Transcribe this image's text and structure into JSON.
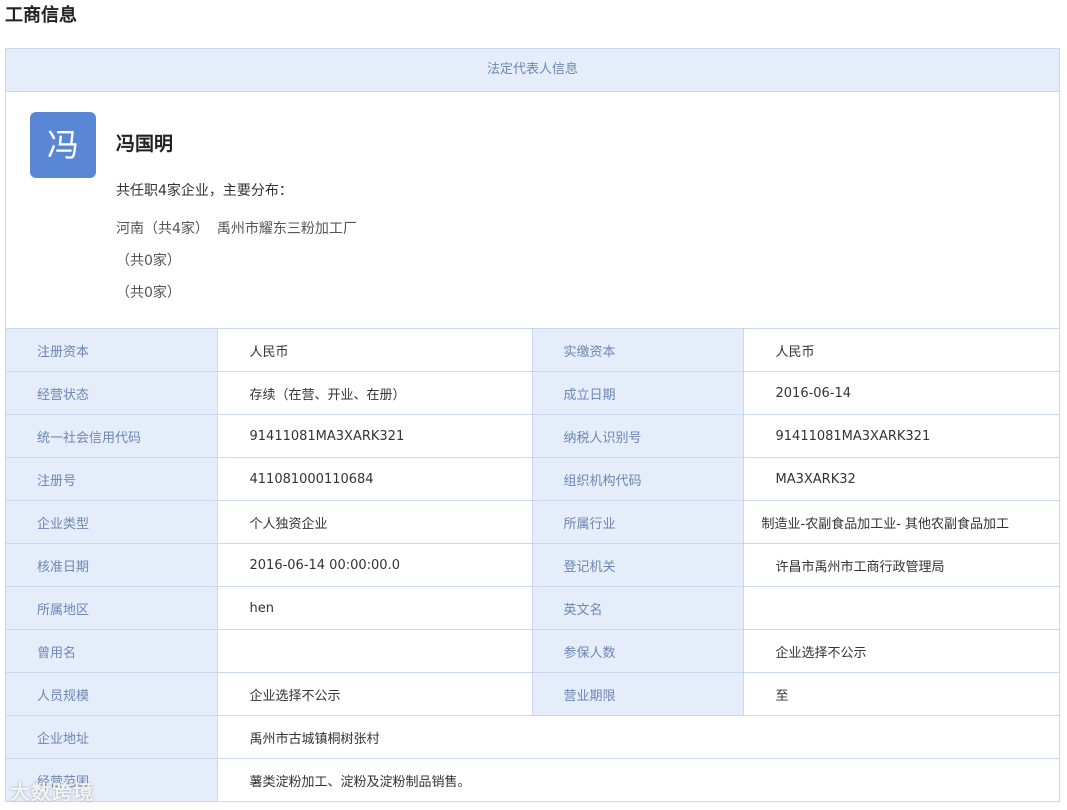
{
  "section_title": "工商信息",
  "panel_header": "法定代表人信息",
  "representative": {
    "avatar_char": "冯",
    "name": "冯国明",
    "summary": "共任职4家企业，主要分布：",
    "distribution": [
      {
        "region": "河南（共4家）",
        "company": "禹州市耀东三粉加工厂"
      },
      {
        "region": "（共0家）",
        "company": ""
      },
      {
        "region": "（共0家）",
        "company": ""
      }
    ]
  },
  "rows": [
    {
      "l1": "注册资本",
      "v1": "人民币",
      "l2": "实缴资本",
      "v2": "人民币"
    },
    {
      "l1": "经营状态",
      "v1": "存续（在营、开业、在册）",
      "l2": "成立日期",
      "v2": "2016-06-14"
    },
    {
      "l1": "统一社会信用代码",
      "v1": "91411081MA3XARK321",
      "l2": "纳税人识别号",
      "v2": "91411081MA3XARK321"
    },
    {
      "l1": "注册号",
      "v1": "411081000110684",
      "l2": "组织机构代码",
      "v2": "MA3XARK32"
    },
    {
      "l1": "企业类型",
      "v1": "个人独资企业",
      "l2": "所属行业",
      "v2": "制造业-农副食品加工业- 其他农副食品加工"
    },
    {
      "l1": "核准日期",
      "v1": "2016-06-14 00:00:00.0",
      "l2": "登记机关",
      "v2": "许昌市禹州市工商行政管理局"
    },
    {
      "l1": "所属地区",
      "v1": "hen",
      "l2": "英文名",
      "v2": ""
    },
    {
      "l1": "曾用名",
      "v1": "",
      "l2": "参保人数",
      "v2": "企业选择不公示"
    },
    {
      "l1": "人员规模",
      "v1": "企业选择不公示",
      "l2": "营业期限",
      "v2": "至"
    }
  ],
  "address": {
    "label": "企业地址",
    "value": "禹州市古城镇桐树张村"
  },
  "scope": {
    "label": "经营范围",
    "value": "薯类淀粉加工、淀粉及淀粉制品销售。"
  },
  "watermark": "大数跨境"
}
